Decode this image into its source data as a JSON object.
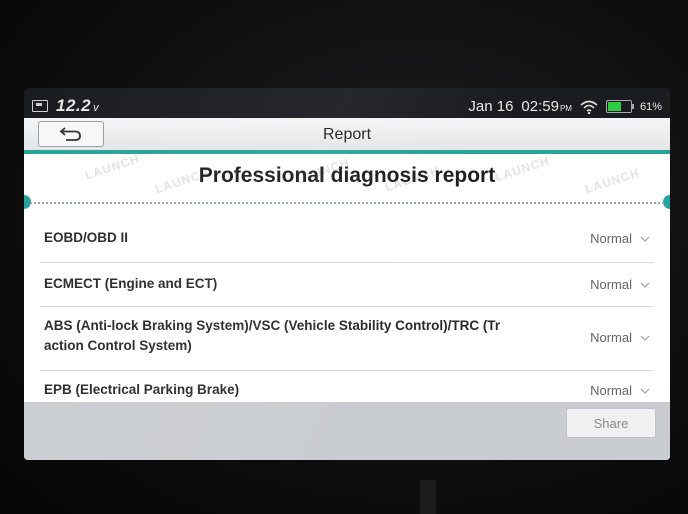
{
  "status_bar": {
    "voltage": "12.2",
    "voltage_unit": "v",
    "date": "Jan 16",
    "time": "02:59",
    "ampm": "PM",
    "battery_percent": "61%",
    "battery_level": 0.61,
    "icons": [
      "screenshot-icon",
      "wifi-icon",
      "battery-icon"
    ]
  },
  "app": {
    "title": "Report",
    "back_icon": "back-arrow-icon"
  },
  "report": {
    "heading": "Professional diagnosis report",
    "watermark": "LAUNCH",
    "rows": [
      {
        "system": "EOBD/OBD II",
        "status": "Normal"
      },
      {
        "system": "ECMECT (Engine and ECT)",
        "status": "Normal"
      },
      {
        "system_line1": "ABS (Anti-lock Braking System)/VSC (Vehicle Stability Control)/TRC (Tr",
        "system_line2": "action Control System)",
        "status": "Normal"
      },
      {
        "system": "EPB (Electrical Parking Brake)",
        "status": "Normal"
      }
    ]
  },
  "footer": {
    "share_label": "Share"
  },
  "colors": {
    "accent_teal": "#27a39b",
    "battery_green": "#2ecc40"
  }
}
